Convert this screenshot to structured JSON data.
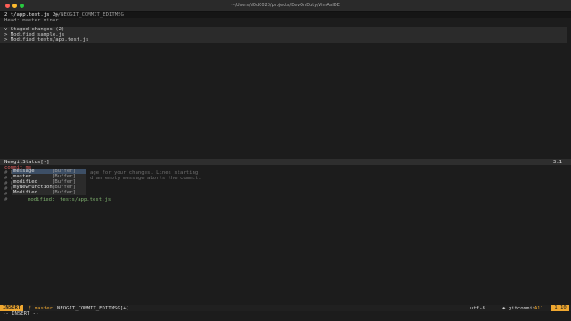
{
  "window": {
    "title": "~/Users/d0d0023/projects/DevOnDuty/VimAsIDE",
    "traffic_colors": [
      "#ff5f57",
      "#febc2e",
      "#28c840"
    ]
  },
  "tabs": {
    "active": "2 t/app.test.js  2+",
    "inactive": ".g/NEOGIT_COMMIT_EDITMSG"
  },
  "neogit": {
    "head": "Head: master minor",
    "staged": "Staged changes (2)",
    "files": [
      "Modified sample.js",
      "Modified tests/app.test.js"
    ]
  },
  "upper_status": {
    "name": "NeogitStatus[-]",
    "position": "3:1"
  },
  "commit": {
    "first_line": "commit ms",
    "comments": [
      "# Ples",
      "# with",
      "# On b",
      "# Chan",
      "#",
      "#"
    ],
    "comment_tails": [
      "age for your changes. Lines starting",
      "d an empty message aborts the commit."
    ],
    "modified_label": "modified:",
    "modified_file": "tests/app.test.js"
  },
  "completion": {
    "items": [
      {
        "word": "message",
        "kind": "[Buffer]"
      },
      {
        "word": "master",
        "kind": "[Buffer]"
      },
      {
        "word": "modified",
        "kind": "[Buffer]"
      },
      {
        "word": "myNewFunction",
        "kind": "[Buffer]"
      },
      {
        "word": "Modified",
        "kind": "[Buffer]"
      }
    ]
  },
  "statusline": {
    "mode": "INSERT",
    "branch": "master",
    "file": "NEOGIT_COMMIT_EDITMSG[+]",
    "encoding": "utf-8",
    "filetype": "gitcommit",
    "percent": "All",
    "linecol": "1:10"
  },
  "cmdline": "-- INSERT --"
}
